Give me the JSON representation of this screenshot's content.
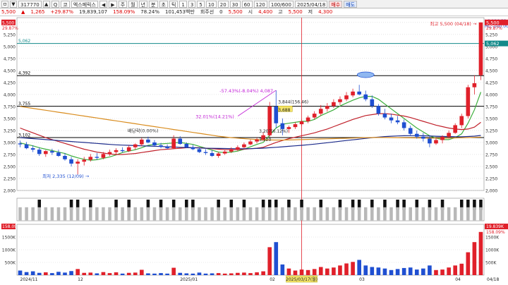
{
  "toolbar": {
    "items": [
      "ㅁ",
      "▼",
      "317770",
      "▲",
      "Q",
      "코",
      "엑스페릭스",
      "◀",
      "▶",
      "주",
      "월",
      "년",
      "분",
      "초",
      "틱",
      "1",
      "3",
      "5",
      "10",
      "20",
      "30",
      "60",
      "120",
      "100/600",
      "2025/04/18"
    ],
    "buy_label": "매수",
    "sell_label": "매도"
  },
  "info_bar": {
    "price": "5,500",
    "change": "▲",
    "change_amount": "1,265",
    "change_pct": "+29.87%",
    "volume": "19,839,107",
    "vol_ratio": "158.09%",
    "vol_ratio2": "78.24%",
    "amount": "101,453백만",
    "credit_label": "회주선",
    "credit_value": "0",
    "price2": "5,500",
    "open_label": "시",
    "open": "4,400",
    "high_label": "고",
    "high": "5,500",
    "low_label": "저",
    "low": "4,300"
  },
  "colors": {
    "up": "#e0202a",
    "down": "#1f4fd1",
    "ma5": "#3cae3c",
    "ma20": "#c0202a",
    "ma60": "#1b2a8a",
    "ma120": "#d98c1e",
    "annot": "#c21fd6"
  },
  "chart_data": {
    "type": "candlestick",
    "price_axis": {
      "ylim": [
        2000,
        5600
      ],
      "ticks": [
        "5,500",
        "5,250",
        "5,000",
        "4,750",
        "4,500",
        "4,250",
        "4,000",
        "3,750",
        "3,500",
        "3,250",
        "3,000",
        "2,750",
        "2,500",
        "2,250",
        "2,000"
      ],
      "grid": true
    },
    "x_labels": [
      "2024/11",
      "12",
      "2025/01",
      "02",
      "03",
      "2025/03/17(월)",
      "04",
      "04/18"
    ],
    "right_labels": {
      "lc": "LC:136.55",
      "hc": "HC:-100.00",
      "top": "5,500",
      "pct": "29.87%",
      "r2": "5,250",
      "r3": "5,062"
    },
    "h_lines": [
      {
        "value": 5062,
        "label": "5,062",
        "color": "#138a8a"
      },
      {
        "value": 4392,
        "label": "4,392",
        "color": "#000000"
      },
      {
        "value": 3755,
        "label": "3,755",
        "color": "#000000"
      },
      {
        "value": 3102,
        "label": "3,102",
        "color": "#000000"
      }
    ],
    "annotations": {
      "high": "최고 5,500 (04/18)",
      "low": "최저 2,335 (12/09)",
      "div": "배당락(0.00%)",
      "a1": "-57.43%(-8.04%) 4,087",
      "a2": "32.01%(14.21%)",
      "a3": "3,844(156.46)",
      "a4": "3,688",
      "a5": "3,207(6.12%)",
      "a6": "3,120"
    },
    "candles": [
      [
        2980,
        3040,
        2900,
        2960
      ],
      [
        2960,
        3010,
        2860,
        2880
      ],
      [
        2880,
        2940,
        2800,
        2850
      ],
      [
        2850,
        2900,
        2720,
        2760
      ],
      [
        2760,
        2840,
        2700,
        2820
      ],
      [
        2820,
        2870,
        2740,
        2790
      ],
      [
        2790,
        2850,
        2700,
        2720
      ],
      [
        2720,
        2780,
        2620,
        2650
      ],
      [
        2650,
        2700,
        2500,
        2560
      ],
      [
        2560,
        2650,
        2335,
        2600
      ],
      [
        2600,
        2700,
        2520,
        2640
      ],
      [
        2640,
        2760,
        2600,
        2700
      ],
      [
        2700,
        2780,
        2640,
        2680
      ],
      [
        2680,
        2800,
        2650,
        2760
      ],
      [
        2760,
        2850,
        2720,
        2800
      ],
      [
        2800,
        2880,
        2750,
        2840
      ],
      [
        2840,
        2900,
        2790,
        2820
      ],
      [
        2820,
        2940,
        2800,
        2900
      ],
      [
        2900,
        2980,
        2850,
        2960
      ],
      [
        2960,
        3100,
        2920,
        3060
      ],
      [
        3060,
        3120,
        2980,
        3000
      ],
      [
        3000,
        3050,
        2920,
        2940
      ],
      [
        2940,
        2990,
        2880,
        2910
      ],
      [
        2910,
        2960,
        2860,
        2880
      ],
      [
        2880,
        3150,
        2860,
        3080
      ],
      [
        3080,
        3130,
        2950,
        2970
      ],
      [
        2970,
        3000,
        2880,
        2900
      ],
      [
        2900,
        2950,
        2840,
        2860
      ],
      [
        2860,
        2900,
        2780,
        2800
      ],
      [
        2800,
        2860,
        2740,
        2780
      ],
      [
        2780,
        2840,
        2700,
        2720
      ],
      [
        2720,
        2800,
        2680,
        2770
      ],
      [
        2770,
        2840,
        2740,
        2810
      ],
      [
        2810,
        2900,
        2780,
        2860
      ],
      [
        2860,
        2940,
        2820,
        2900
      ],
      [
        2900,
        3000,
        2880,
        2960
      ],
      [
        2960,
        3060,
        2940,
        3020
      ],
      [
        3020,
        3100,
        2980,
        3060
      ],
      [
        3060,
        3207,
        3040,
        3150
      ],
      [
        3150,
        3844,
        3120,
        3750
      ],
      [
        3750,
        4087,
        3300,
        3400
      ],
      [
        3400,
        3500,
        3150,
        3280
      ],
      [
        3280,
        3350,
        3200,
        3320
      ],
      [
        3320,
        3420,
        3280,
        3380
      ],
      [
        3380,
        3480,
        3340,
        3440
      ],
      [
        3440,
        3560,
        3400,
        3520
      ],
      [
        3520,
        3650,
        3480,
        3600
      ],
      [
        3600,
        3780,
        3560,
        3700
      ],
      [
        3700,
        3820,
        3640,
        3760
      ],
      [
        3760,
        3900,
        3720,
        3840
      ],
      [
        3840,
        3960,
        3780,
        3900
      ],
      [
        3900,
        4050,
        3860,
        3980
      ],
      [
        3980,
        4120,
        3940,
        4060
      ],
      [
        4060,
        4200,
        3980,
        4000
      ],
      [
        4000,
        4080,
        3860,
        3900
      ],
      [
        3900,
        3980,
        3720,
        3760
      ],
      [
        3760,
        3800,
        3560,
        3600
      ],
      [
        3600,
        3700,
        3480,
        3520
      ],
      [
        3520,
        3600,
        3400,
        3460
      ],
      [
        3460,
        3550,
        3380,
        3420
      ],
      [
        3420,
        3480,
        3250,
        3300
      ],
      [
        3300,
        3350,
        3150,
        3180
      ],
      [
        3180,
        3250,
        3080,
        3120
      ],
      [
        3120,
        3200,
        3020,
        3080
      ],
      [
        3080,
        3150,
        2900,
        2980
      ],
      [
        2980,
        3100,
        2950,
        3050
      ],
      [
        3050,
        3150,
        2980,
        3120
      ],
      [
        3120,
        3250,
        3080,
        3200
      ],
      [
        3200,
        3400,
        3180,
        3360
      ],
      [
        3360,
        3600,
        3300,
        3550
      ],
      [
        3550,
        4200,
        3500,
        4150
      ],
      [
        4150,
        4400,
        4000,
        4234
      ],
      [
        4400,
        5500,
        4300,
        5500
      ]
    ],
    "ma": [
      {
        "name": "ma5",
        "values": [
          2990,
          2960,
          2930,
          2890,
          2860,
          2830,
          2800,
          2770,
          2720,
          2680,
          2650,
          2630,
          2640,
          2670,
          2700,
          2740,
          2790,
          2820,
          2850,
          2890,
          2940,
          2960,
          2970,
          2980,
          2990,
          3000,
          2980,
          2960,
          2920,
          2880,
          2840,
          2800,
          2790,
          2800,
          2820,
          2860,
          2910,
          2960,
          3000,
          3150,
          3300,
          3380,
          3400,
          3420,
          3440,
          3440,
          3480,
          3560,
          3620,
          3680,
          3760,
          3820,
          3880,
          3930,
          3960,
          3960,
          3900,
          3800,
          3700,
          3600,
          3500,
          3400,
          3300,
          3220,
          3140,
          3090,
          3060,
          3060,
          3100,
          3180,
          3400,
          3680,
          4050
        ]
      },
      {
        "name": "ma20",
        "values": [
          3300,
          3250,
          3200,
          3150,
          3100,
          3060,
          3020,
          2980,
          2940,
          2900,
          2860,
          2830,
          2800,
          2780,
          2760,
          2750,
          2750,
          2760,
          2770,
          2790,
          2810,
          2830,
          2850,
          2860,
          2870,
          2880,
          2890,
          2890,
          2890,
          2880,
          2870,
          2860,
          2850,
          2850,
          2850,
          2860,
          2870,
          2880,
          2900,
          2950,
          3000,
          3040,
          3080,
          3110,
          3140,
          3170,
          3200,
          3240,
          3280,
          3330,
          3380,
          3430,
          3480,
          3520,
          3560,
          3580,
          3600,
          3600,
          3590,
          3570,
          3550,
          3520,
          3480,
          3440,
          3400,
          3360,
          3330,
          3300,
          3280,
          3270,
          3280,
          3320,
          3420
        ]
      },
      {
        "name": "ma60",
        "values": [
          3100,
          3090,
          3080,
          3070,
          3060,
          3050,
          3040,
          3030,
          3020,
          3010,
          3000,
          2990,
          2980,
          2970,
          2960,
          2950,
          2945,
          2940,
          2935,
          2930,
          2925,
          2920,
          2915,
          2910,
          2905,
          2900,
          2895,
          2890,
          2885,
          2880,
          2878,
          2876,
          2874,
          2872,
          2870,
          2870,
          2872,
          2876,
          2882,
          2890,
          2900,
          2910,
          2920,
          2930,
          2940,
          2952,
          2966,
          2980,
          2995,
          3010,
          3025,
          3040,
          3055,
          3070,
          3085,
          3100,
          3112,
          3122,
          3130,
          3136,
          3140,
          3142,
          3142,
          3140,
          3136,
          3130,
          3126,
          3122,
          3120,
          3120,
          3124,
          3132,
          3146
        ]
      },
      {
        "name": "ma120",
        "values": [
          3750,
          3730,
          3710,
          3690,
          3670,
          3650,
          3630,
          3610,
          3590,
          3570,
          3550,
          3530,
          3510,
          3490,
          3470,
          3450,
          3430,
          3410,
          3390,
          3370,
          3350,
          3330,
          3310,
          3290,
          3270,
          3250,
          3230,
          3210,
          3190,
          3170,
          3150,
          3130,
          3115,
          3100,
          3090,
          3080,
          3070,
          3062,
          3056,
          3052,
          3050,
          3050,
          3052,
          3056,
          3060,
          3064,
          3068,
          3072,
          3076,
          3080,
          3084,
          3088,
          3092,
          3096,
          3100,
          3102,
          3104,
          3104,
          3102,
          3100,
          3098,
          3096,
          3094,
          3092,
          3090,
          3090,
          3090,
          3092,
          3094,
          3098,
          3102,
          3106,
          3112
        ]
      }
    ],
    "signals": [
      0,
      0,
      0,
      1,
      0,
      0,
      0,
      0,
      1,
      1,
      0,
      1,
      0,
      0,
      0,
      1,
      0,
      1,
      0,
      0,
      1,
      0,
      1,
      0,
      1,
      0,
      1,
      1,
      0,
      0,
      0,
      1,
      0,
      1,
      0,
      1,
      0,
      0,
      1,
      1,
      1,
      0,
      1,
      0,
      1,
      0,
      0,
      1,
      0,
      0,
      1,
      0,
      1,
      1,
      0,
      1,
      0,
      1,
      0,
      1,
      1,
      0,
      1,
      0,
      1,
      0,
      1,
      0,
      0,
      1,
      1,
      1,
      1
    ],
    "volume": {
      "ylim": [
        0,
        2000
      ],
      "ticks": [
        "1500K",
        "1000K",
        "500K"
      ],
      "top_label": "158.09%",
      "right_top": "19.839K",
      "values": [
        180,
        120,
        150,
        90,
        110,
        80,
        130,
        100,
        160,
        240,
        90,
        100,
        70,
        120,
        80,
        110,
        60,
        90,
        100,
        210,
        70,
        60,
        80,
        60,
        290,
        90,
        70,
        60,
        100,
        60,
        70,
        80,
        60,
        70,
        90,
        100,
        80,
        110,
        150,
        1100,
        1300,
        420,
        260,
        180,
        220,
        200,
        240,
        320,
        260,
        300,
        380,
        460,
        520,
        600,
        380,
        320,
        300,
        260,
        200,
        240,
        280,
        300,
        220,
        260,
        380,
        200,
        220,
        300,
        380,
        450,
        900,
        1300,
        1700
      ]
    }
  }
}
